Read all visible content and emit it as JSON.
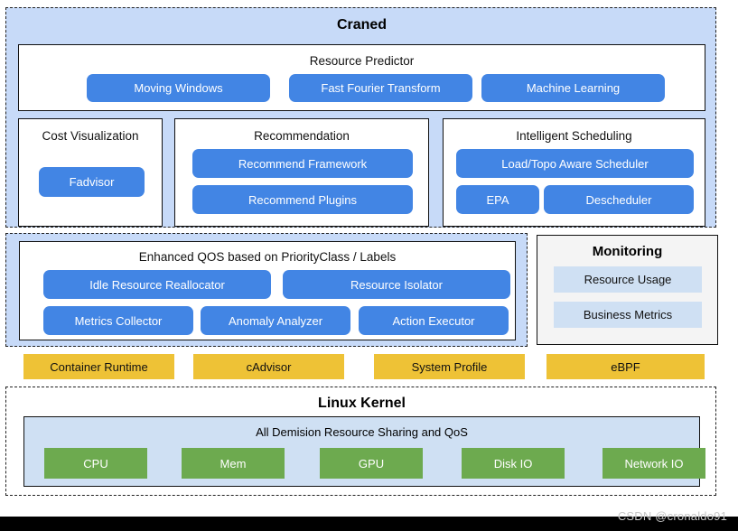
{
  "craned": {
    "title": "Craned",
    "resource_predictor": {
      "title": "Resource Predictor",
      "items": [
        {
          "label": "Moving Windows"
        },
        {
          "label": "Fast Fourier Transform"
        },
        {
          "label": "Machine Learning"
        }
      ]
    },
    "cost_visualization": {
      "title": "Cost Visualization",
      "items": [
        {
          "label": "Fadvisor"
        }
      ]
    },
    "recommendation": {
      "title": "Recommendation",
      "items": [
        {
          "label": "Recommend Framework"
        },
        {
          "label": "Recommend Plugins"
        }
      ]
    },
    "intelligent_scheduling": {
      "title": "Intelligent Scheduling",
      "items": [
        {
          "label": "Load/Topo Aware Scheduler"
        },
        {
          "label": "EPA"
        },
        {
          "label": "Descheduler"
        }
      ]
    }
  },
  "qos": {
    "title": "Enhanced QOS based on PriorityClass / Labels",
    "items": [
      {
        "label": "Idle Resource Reallocator"
      },
      {
        "label": "Resource Isolator"
      },
      {
        "label": "Metrics Collector"
      },
      {
        "label": "Anomaly Analyzer"
      },
      {
        "label": "Action Executor"
      }
    ]
  },
  "monitoring": {
    "title": "Monitoring",
    "items": [
      {
        "label": "Resource Usage"
      },
      {
        "label": "Business Metrics"
      }
    ]
  },
  "agents_row": {
    "items": [
      {
        "label": "Container Runtime"
      },
      {
        "label": "cAdvisor"
      },
      {
        "label": "System Profile"
      },
      {
        "label": "eBPF"
      }
    ]
  },
  "kernel": {
    "title": "Linux Kernel",
    "subtitle": "All Demision Resource Sharing and QoS",
    "resources": [
      {
        "label": "CPU"
      },
      {
        "label": "Mem"
      },
      {
        "label": "GPU"
      },
      {
        "label": "Disk IO"
      },
      {
        "label": "Network IO"
      }
    ]
  },
  "watermark": {
    "text": "CSDN @cronaldo91"
  },
  "colors": {
    "panel_blue_bg": "#c7daf8",
    "pill_blue": "#4285e4",
    "yellow": "#eec236",
    "green": "#6daa4f",
    "monitor_bg": "#f4f4f4",
    "monitor_item": "#cfe0f3"
  }
}
